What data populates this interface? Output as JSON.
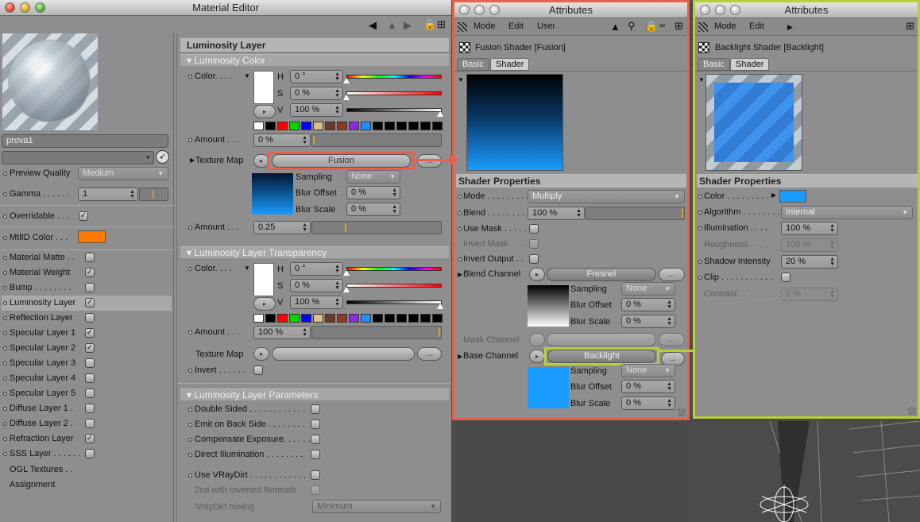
{
  "material_editor": {
    "title": "Material Editor",
    "material_name": "prova1",
    "sidebar": {
      "preview_quality_label": "Preview Quality",
      "preview_quality_value": "Medium",
      "gamma_label": "Gamma . . . . . .",
      "gamma_value": "1",
      "overridable_label": "Overridable . . .",
      "mtlid_label": "MtlID Color . . .",
      "items": [
        {
          "label": "Material Matte . .",
          "checked": false
        },
        {
          "label": "Material Weight",
          "checked": true
        },
        {
          "label": "Bump . . . . . . . .",
          "checked": false
        },
        {
          "label": "Luminosity Layer",
          "checked": true
        },
        {
          "label": "Reflection Layer",
          "checked": false
        },
        {
          "label": "Specular Layer 1",
          "checked": true
        },
        {
          "label": "Specular Layer 2",
          "checked": true
        },
        {
          "label": "Specular Layer 3",
          "checked": false
        },
        {
          "label": "Specular Layer 4",
          "checked": false
        },
        {
          "label": "Specular Layer 5",
          "checked": false
        },
        {
          "label": "Diffuse Layer 1 .",
          "checked": false
        },
        {
          "label": "Diffuse Layer 2 .",
          "checked": false
        },
        {
          "label": "Refraction Layer",
          "checked": true
        },
        {
          "label": "SSS Layer . . . . . .",
          "checked": false
        }
      ],
      "ogl_textures": "OGL Textures . .",
      "assignment": "Assignment"
    },
    "panel": {
      "header": "Luminosity Layer",
      "color_section": "Luminosity Color",
      "color_label": "Color. . . .",
      "h_label": "H",
      "s_label": "S",
      "v_label": "V",
      "h_value": "0 °",
      "s_value": "0 %",
      "v_value": "100 %",
      "amount_label": "Amount . . .",
      "amount_value": "0 %",
      "texture_map_label": "Texture Map",
      "texture_map_value": "Fusion",
      "ellipsis": "...",
      "sampling_label": "Sampling",
      "sampling_value": "None",
      "blur_offset_label": "Blur Offset",
      "blur_offset_value": "0 %",
      "blur_scale_label": "Blur Scale",
      "blur_scale_value": "0 %",
      "amount2_label": "Amount . . .",
      "amount2_value": "0.25",
      "transparency_section": "Luminosity Layer Transparency",
      "t_color_label": "Color. . . .",
      "t_h_value": "0 °",
      "t_s_value": "0 %",
      "t_v_value": "100 %",
      "t_amount_label": "Amount . . .",
      "t_amount_value": "100 %",
      "t_texture_map_label": "Texture Map",
      "invert_label": "Invert . . . . . .",
      "params_section": "Luminosity Layer Parameters",
      "params": [
        {
          "label": "Double Sided . . . . . . . . . . . .",
          "dim": false
        },
        {
          "label": "Emit on Back Side . . . . . . . .",
          "dim": false
        },
        {
          "label": "Compensate Exposure. . . . . .",
          "dim": false
        },
        {
          "label": "Direct Illumination . . . . . . . .",
          "dim": false
        },
        {
          "label": "Use VRayDirt . . . . . . . . . . . .",
          "dim": false
        },
        {
          "label": "2nd with Inverted Normals",
          "dim": true
        }
      ],
      "vraydirt_label": "VrayDirt mixing",
      "vraydirt_value": "Minimum"
    }
  },
  "attr1": {
    "title": "Attributes",
    "menu": [
      "Mode",
      "Edit",
      "User"
    ],
    "shader_name": "Fusion Shader [Fusion]",
    "tabs": [
      "Basic",
      "Shader"
    ],
    "section": "Shader Properties",
    "mode_label": "Mode . . . . . . . . .",
    "mode_value": "Multiply",
    "blend_label": "Blend . . . . . . . . .",
    "blend_value": "100 %",
    "use_mask_label": "Use Mask . . . . .",
    "invert_mask_label": "Invert Mask . . . .",
    "invert_output_label": "Invert Output . .",
    "blend_channel_label": "Blend Channel",
    "blend_channel_value": "Fresnel",
    "sampling_label": "Sampling",
    "sampling_value": "None",
    "blur_offset_label": "Blur Offset",
    "blur_offset_value": "0 %",
    "blur_scale_label": "Blur Scale",
    "blur_scale_value": "0 %",
    "mask_channel_label": "Mask Channel",
    "base_channel_label": "Base Channel",
    "base_channel_value": "Backlight",
    "b_sampling_value": "None",
    "b_blur_offset_value": "0 %",
    "b_blur_scale_value": "0 %",
    "ellipsis": "...",
    "border_color": "#e8604a"
  },
  "attr2": {
    "title": "Attributes",
    "menu": [
      "Mode",
      "Edit"
    ],
    "shader_name": "Backlight Shader [Backlight]",
    "tabs": [
      "Basic",
      "Shader"
    ],
    "section": "Shader Properties",
    "color_label": "Color . . . . . . . . .",
    "algorithm_label": "Algorithm . . . . . . . .",
    "algorithm_value": "Internal",
    "illumination_label": "Illumination . . . .",
    "illumination_value": "100 %",
    "roughness_label": "Roughness . . . . .",
    "roughness_value": "100 %",
    "shadow_label": "Shadow Intensity",
    "shadow_value": "20 %",
    "clip_label": "Clip . . . . . . . . . . .",
    "contrast_label": "Contrast . . . . . . .",
    "contrast_value": "0 %",
    "border_color": "#b5d138"
  },
  "colors": {
    "accent_orange": "#ff7a00",
    "shader_blue": "#1a9bff",
    "highlight_green": "#b5d138",
    "highlight_red": "#e8604a"
  }
}
